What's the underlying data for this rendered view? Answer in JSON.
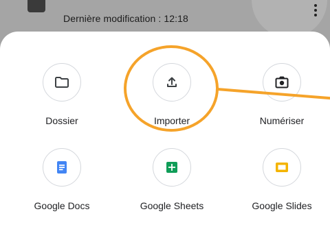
{
  "header": {
    "modified_text": "Dernière modification : 12:18"
  },
  "sheet": {
    "items": [
      {
        "label": "Dossier",
        "icon": "folder-icon"
      },
      {
        "label": "Importer",
        "icon": "upload-icon"
      },
      {
        "label": "Numériser",
        "icon": "camera-icon"
      },
      {
        "label": "Google Docs",
        "icon": "google-docs-icon",
        "color": "#4285f4"
      },
      {
        "label": "Google Sheets",
        "icon": "google-sheets-icon",
        "color": "#0f9d58"
      },
      {
        "label": "Google Slides",
        "icon": "google-slides-icon",
        "color": "#f4b400"
      }
    ]
  },
  "annotation": {
    "color": "#f5a32a"
  }
}
